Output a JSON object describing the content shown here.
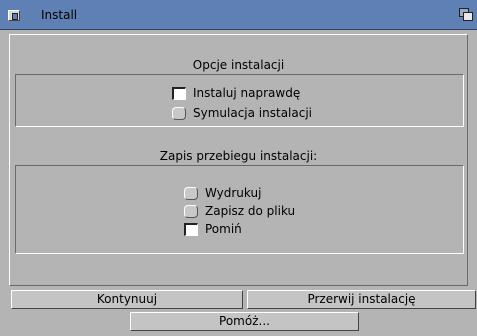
{
  "window": {
    "title": "Install"
  },
  "install_options": {
    "heading": "Opcje instalacji",
    "options": [
      {
        "label": "Instaluj naprawdę",
        "selected": true
      },
      {
        "label": "Symulacja instalacji",
        "selected": false
      }
    ]
  },
  "log_options": {
    "heading": "Zapis przebiegu instalacji:",
    "options": [
      {
        "label": "Wydrukuj",
        "selected": false
      },
      {
        "label": "Zapisz do pliku",
        "selected": false
      },
      {
        "label": "Pomiń",
        "selected": true
      }
    ]
  },
  "buttons": {
    "continue": "Kontynuuj",
    "abort": "Przerwij instalację",
    "help": "Pomóż..."
  },
  "colors": {
    "titlebar": "#5e80b4",
    "window_bg": "#b4b4b4"
  }
}
